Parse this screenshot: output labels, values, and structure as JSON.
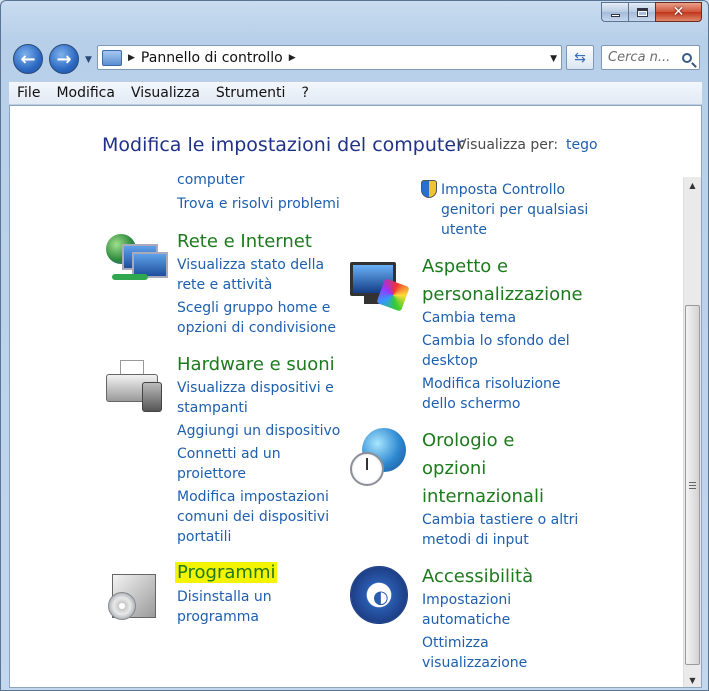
{
  "window": {
    "caption": {
      "minimize": "minimize",
      "maximize": "maximize",
      "close": "close"
    }
  },
  "nav": {
    "breadcrumb": "Pannello di controllo",
    "search_placeholder": "Cerca n..."
  },
  "menu": [
    "File",
    "Modifica",
    "Visualizza",
    "Strumenti",
    "?"
  ],
  "header": {
    "title": "Modifica le impostazioni del computer",
    "view_by_label": "Visualizza per:",
    "view_by_value": "tego"
  },
  "left": {
    "top_cut_link": "computer",
    "troubleshoot": "Trova e risolvi problemi",
    "network": {
      "title": "Rete e Internet",
      "links": [
        "Visualizza stato della",
        "rete e attività",
        "Scegli gruppo home e",
        "opzioni di condivisione"
      ]
    },
    "hardware": {
      "title": "Hardware e suoni",
      "links": [
        "Visualizza dispositivi e",
        "stampanti",
        "Aggiungi un dispositivo",
        "Connetti ad un",
        "proiettore",
        "Modifica impostazioni",
        "comuni dei dispositivi",
        "portatili"
      ]
    },
    "programs": {
      "title": "Programmi",
      "links": [
        "Disinstalla un",
        "programma"
      ]
    }
  },
  "right": {
    "parental": [
      "Imposta Controllo",
      "genitori per qualsiasi",
      "utente"
    ],
    "appearance": {
      "title_lines": [
        "Aspetto e",
        "personalizzazione"
      ],
      "links": [
        "Cambia tema",
        "Cambia lo sfondo del",
        "desktop",
        "Modifica risoluzione",
        "dello schermo"
      ]
    },
    "clock": {
      "title_lines": [
        "Orologio e",
        "opzioni",
        "internazionali"
      ],
      "links": [
        "Cambia tastiere o altri",
        "metodi di input"
      ]
    },
    "access": {
      "title": "Accessibilità",
      "links": [
        "Impostazioni",
        "automatiche",
        "Ottimizza",
        "visualizzazione"
      ]
    }
  },
  "colors": {
    "link": "#1e5fae",
    "category": "#1d7a1d",
    "title": "#1e3287",
    "highlight": "#f4f400"
  }
}
